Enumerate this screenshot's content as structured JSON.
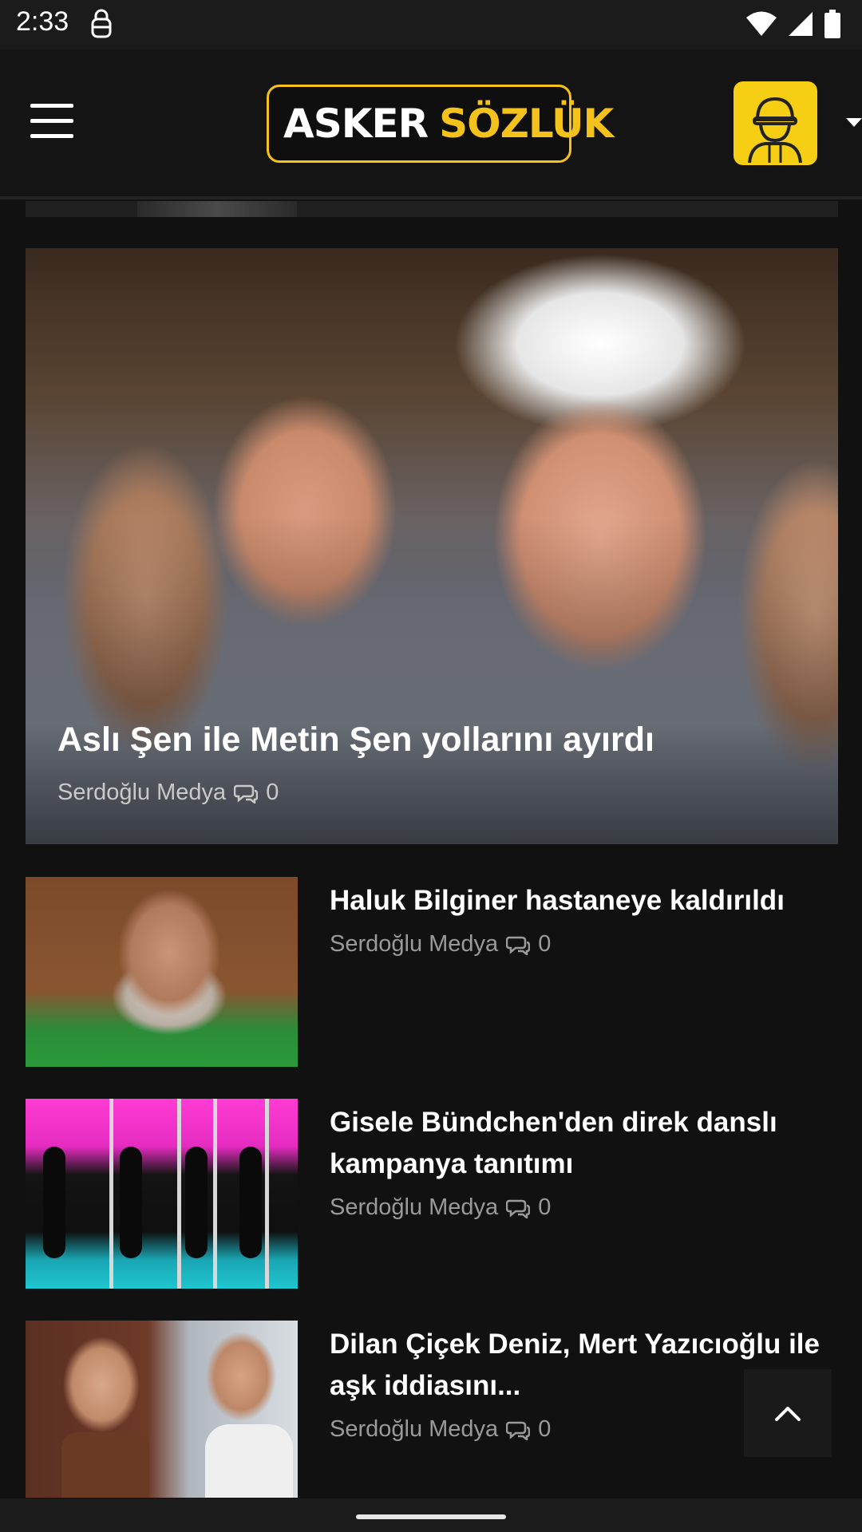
{
  "status_bar": {
    "time": "2:33"
  },
  "header": {
    "logo_part1": "ASKER",
    "logo_part2": "SÖZLÜK"
  },
  "featured": {
    "title": "Aslı Şen ile Metin Şen yollarını ayırdı",
    "author": "Serdoğlu Medya",
    "comments": "0"
  },
  "articles": [
    {
      "title": "Haluk Bilginer hastaneye kaldırıldı",
      "author": "Serdoğlu Medya",
      "comments": "0"
    },
    {
      "title": "Gisele Bündchen'den direk danslı kampanya tanıtımı",
      "author": "Serdoğlu Medya",
      "comments": "0"
    },
    {
      "title": "Dilan Çiçek Deniz, Mert Yazıcıoğlu ile aşk iddiasını...",
      "author": "Serdoğlu Medya",
      "comments": "0"
    }
  ],
  "colors": {
    "accent": "#f4c21a",
    "background": "#111111",
    "meta_text": "#9a9a9a"
  },
  "icons": [
    "menu-icon",
    "user-avatar-icon",
    "comment-icon",
    "chevron-up-icon",
    "wifi-icon",
    "signal-icon",
    "battery-icon"
  ]
}
